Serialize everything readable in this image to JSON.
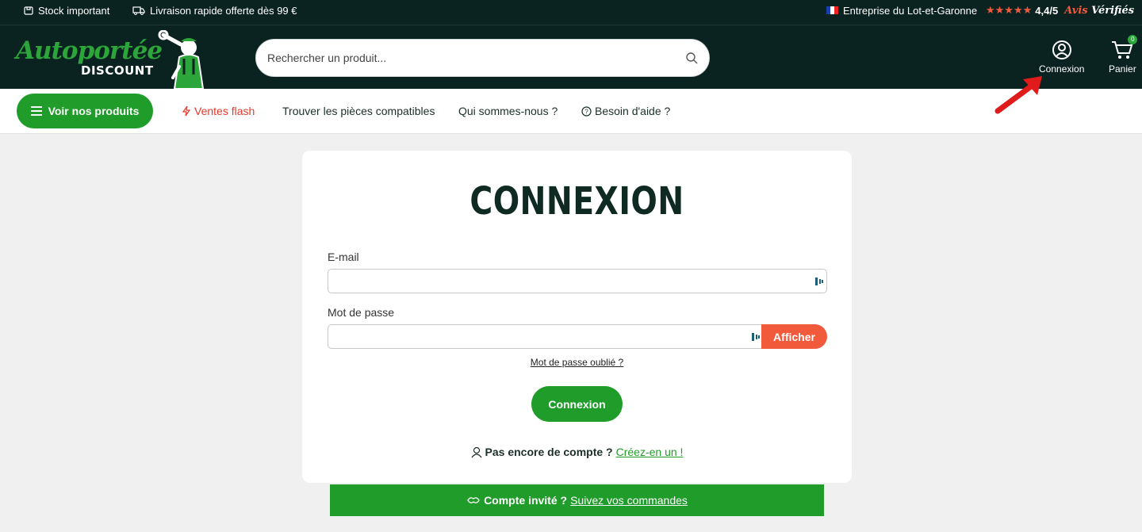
{
  "topbar": {
    "stock_label": "Stock important",
    "delivery_label": "Livraison rapide offerte dès 99 €",
    "company_label": "Entreprise du Lot-et-Garonne",
    "rating_stars": "★★★★★",
    "rating_value": "4,4/5",
    "reviews_brand_1": "Avis",
    "reviews_brand_2": "Vérifiés"
  },
  "header": {
    "logo_line1": "Autoportée",
    "logo_line2": "DISCOUNT",
    "search_placeholder": "Rechercher un produit...",
    "account_label": "Connexion",
    "cart_label": "Panier",
    "cart_count": "0"
  },
  "nav": {
    "products_button": "Voir nos produits",
    "flash_sales": "Ventes flash",
    "compatible_parts": "Trouver les pièces compatibles",
    "about": "Qui sommes-nous ?",
    "help": "Besoin d'aide ?"
  },
  "login": {
    "title": "CONNEXION",
    "email_label": "E-mail",
    "email_value": "",
    "password_label": "Mot de passe",
    "password_value": "",
    "show_button": "Afficher",
    "forgot_link": "Mot de passe oublié ?",
    "submit_button": "Connexion",
    "no_account_text": "Pas encore de compte ?",
    "create_link": "Créez-en un !"
  },
  "guest": {
    "text": "Compte invité ?",
    "link": "Suivez vos commandes"
  },
  "colors": {
    "dark_green": "#0b2320",
    "brand_green": "#209c2a",
    "accent_orange": "#f25a3c"
  }
}
